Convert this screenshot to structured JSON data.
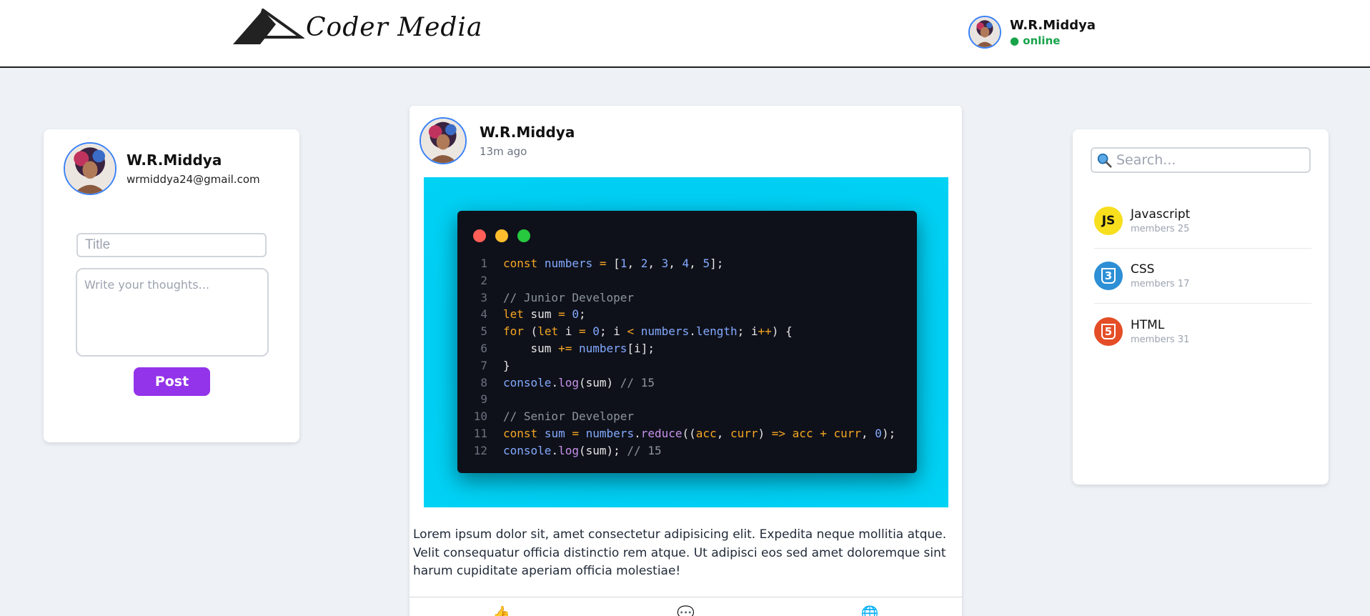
{
  "header": {
    "logo_text": "Coder Media",
    "user": {
      "name": "W.R.Middya",
      "status": "● online"
    }
  },
  "profile": {
    "name": "W.R.Middya",
    "email": "wrmiddya24@gmail.com"
  },
  "composer": {
    "title_placeholder": "Title",
    "body_placeholder": "Write your thoughts...",
    "post_label": "Post"
  },
  "post": {
    "author": "W.R.Middya",
    "time": "13m ago",
    "text": "Lorem ipsum dolor sit, amet consectetur adipisicing elit. Expedita neque mollitia atque. Velit consequatur officia distinctio rem atque. Ut adipisci eos sed amet doloremque sint harum cupiditate aperiam officia molestiae!",
    "code_lines": [
      "1",
      "2",
      "3",
      "4",
      "5",
      "6",
      "7",
      "8",
      "9",
      "10",
      "11",
      "12"
    ],
    "actions": {
      "like": "like-icon",
      "comment": "comment-icon",
      "share": "share-icon"
    }
  },
  "sidebar": {
    "search_placeholder": "Search...",
    "groups": [
      {
        "name": "Javascript",
        "members": "members 25",
        "icon": "js-icon",
        "badge": "JS",
        "color": "#f7df1e"
      },
      {
        "name": "CSS",
        "members": "members 17",
        "icon": "css-icon",
        "badge": "3",
        "color": "#2d8fd5"
      },
      {
        "name": "HTML",
        "members": "members 31",
        "icon": "html-icon",
        "badge": "5",
        "color": "#e44d26"
      }
    ]
  },
  "colors": {
    "accent": "#9333ea",
    "online": "#16a34a",
    "avatar_ring": "#3b82f6",
    "post_bg": "#00cdf2"
  }
}
